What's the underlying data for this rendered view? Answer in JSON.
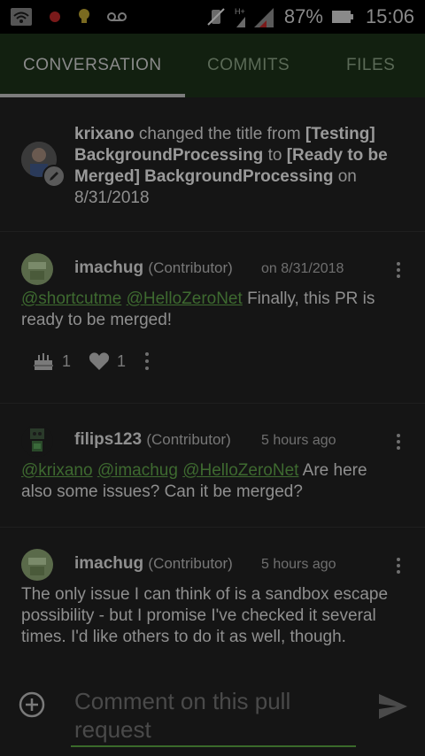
{
  "status_bar": {
    "battery_percent": "87%",
    "time": "15:06",
    "network_type": "H+",
    "icons": [
      "wifi-icon",
      "notification-dot-icon",
      "lightbulb-icon",
      "voicemail-icon",
      "mute-icon",
      "signal-icon",
      "battery-icon"
    ]
  },
  "tabs": [
    {
      "label": "CONVERSATION",
      "active": true
    },
    {
      "label": "COMMITS",
      "active": false
    },
    {
      "label": "FILES",
      "active": false
    }
  ],
  "title_event": {
    "user": "krixano",
    "action": "changed the title from",
    "old_title": "[Testing] BackgroundProcessing",
    "connector": "to",
    "new_title": "[Ready to be Merged] BackgroundProcessing",
    "date_prefix": "on",
    "date": "8/31/2018"
  },
  "comments": [
    {
      "user": "imachug",
      "role": "(Contributor)",
      "time": "on 8/31/2018",
      "mentions": [
        "@shortcutme",
        "@HelloZeroNet"
      ],
      "text": "Finally, this PR is ready to be merged!",
      "reactions": {
        "cake_count": "1",
        "heart_count": "1"
      }
    },
    {
      "user": "filips123",
      "role": "(Contributor)",
      "time": "5 hours ago",
      "mentions": [
        "@krixano",
        "@imachug",
        "@HelloZeroNet"
      ],
      "text": "Are here also some issues? Can it be merged?"
    },
    {
      "user": "imachug",
      "role": "(Contributor)",
      "time": "5 hours ago",
      "text": "The only issue I can think of is a sandbox escape possibility - but I promise I've checked it several times. I'd like others to do it as well, though."
    }
  ],
  "composer": {
    "placeholder": "Comment on this pull request"
  },
  "colors": {
    "tab_bar": "#122010",
    "mention": "#3e6a30",
    "input_underline": "#3a6a2a"
  }
}
